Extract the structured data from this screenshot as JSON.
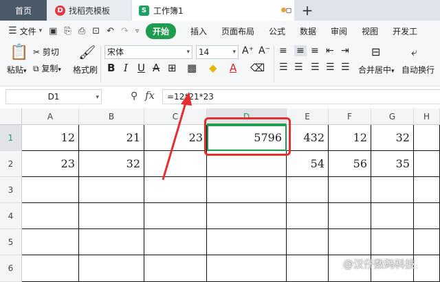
{
  "tabs": {
    "home": "首页",
    "template": "找稻壳模板",
    "document": "工作簿1",
    "add": "+",
    "close": "▪"
  },
  "menu": {
    "file": "文件",
    "start": "开始",
    "items": [
      "插入",
      "页面布局",
      "公式",
      "数据",
      "审阅",
      "视图",
      "开发工"
    ]
  },
  "ribbon": {
    "paste": "粘贴",
    "cut": "剪切",
    "copy": "复制",
    "format_painter": "格式刷",
    "font": "宋体",
    "font_size": "14",
    "merge_center": "合并居中",
    "wrap_text": "自动换行",
    "bold": "B",
    "italic": "I",
    "underline": "U",
    "strike": "A",
    "grow": "A⁺",
    "shrink": "A⁻"
  },
  "formula_bar": {
    "name_box": "D1",
    "fx": "fx",
    "formula": "=12*21*23"
  },
  "grid": {
    "columns": [
      "A",
      "B",
      "C",
      "D",
      "E",
      "F",
      "G",
      "H"
    ],
    "rows": [
      "1",
      "2",
      "3",
      "4",
      "5",
      "6"
    ],
    "cells": {
      "A1": "12",
      "B1": "21",
      "C1": "23",
      "D1": "5796",
      "E1": "432",
      "F1": "12",
      "G1": "32",
      "A2": "23",
      "B2": "32",
      "E2": "54",
      "F2": "56",
      "G2": "35"
    },
    "active_cell": "D1"
  },
  "colors": {
    "accent": "#1e9d4f",
    "annotation": "#e62e2e"
  },
  "watermark": "@汉仔数码科技"
}
